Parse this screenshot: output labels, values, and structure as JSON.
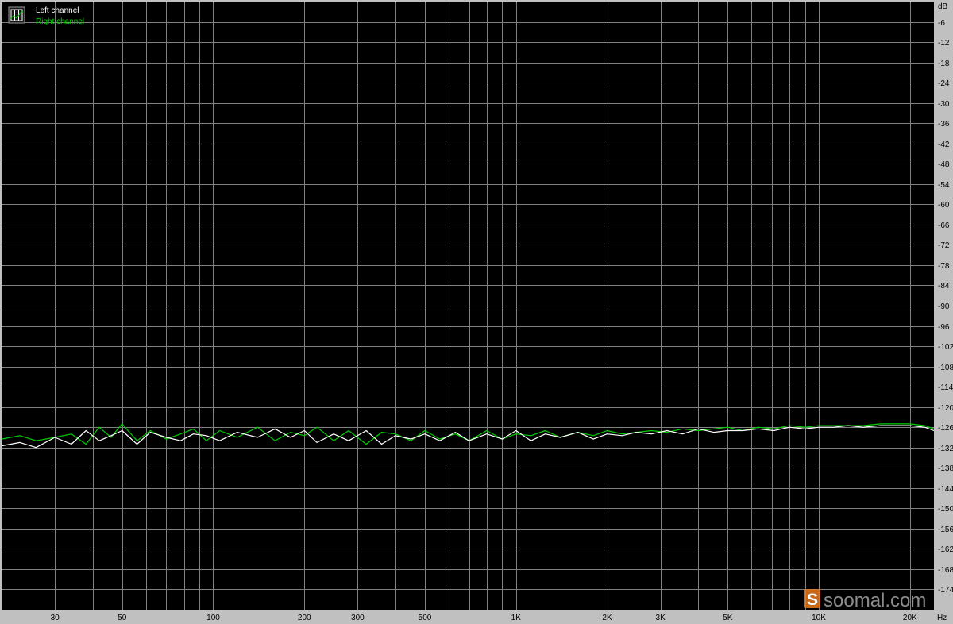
{
  "chart_data": {
    "type": "line",
    "title": "",
    "xlabel": "",
    "ylabel": "",
    "x_scale": "log",
    "xlim": [
      20,
      24000
    ],
    "ylim": [
      -180,
      0
    ],
    "x_unit": "Hz",
    "y_unit": "dB",
    "x_ticks": [
      {
        "value": 30,
        "label": "30"
      },
      {
        "value": 50,
        "label": "50"
      },
      {
        "value": 100,
        "label": "100"
      },
      {
        "value": 200,
        "label": "200"
      },
      {
        "value": 300,
        "label": "300"
      },
      {
        "value": 500,
        "label": "500"
      },
      {
        "value": 1000,
        "label": "1K"
      },
      {
        "value": 2000,
        "label": "2K"
      },
      {
        "value": 3000,
        "label": "3K"
      },
      {
        "value": 5000,
        "label": "5K"
      },
      {
        "value": 10000,
        "label": "10K"
      },
      {
        "value": 20000,
        "label": "20K"
      }
    ],
    "y_ticks": [
      -6,
      -12,
      -18,
      -24,
      -30,
      -36,
      -42,
      -48,
      -54,
      -60,
      -66,
      -72,
      -78,
      -84,
      -90,
      -96,
      -102,
      -108,
      -114,
      -120,
      -126,
      -132,
      -138,
      -144,
      -150,
      -156,
      -162,
      -168,
      -174
    ],
    "grid": true,
    "legend_position": "top-left",
    "series": [
      {
        "name": "Left channel",
        "color": "#ffffff",
        "x": [
          20,
          23,
          26,
          30,
          34,
          38,
          42,
          46,
          50,
          56,
          62,
          70,
          78,
          86,
          95,
          105,
          120,
          140,
          160,
          180,
          200,
          220,
          250,
          280,
          320,
          360,
          400,
          450,
          500,
          560,
          630,
          700,
          800,
          900,
          1000,
          1120,
          1250,
          1400,
          1600,
          1800,
          2000,
          2240,
          2500,
          2800,
          3150,
          3550,
          4000,
          4500,
          5000,
          5600,
          6300,
          7100,
          8000,
          9000,
          10000,
          11200,
          12500,
          14000,
          16000,
          18000,
          20000,
          22400,
          24000
        ],
        "y": [
          -131.5,
          -130.5,
          -132,
          -129,
          -131,
          -127,
          -130,
          -128.5,
          -127,
          -131,
          -127.5,
          -129,
          -130,
          -128,
          -128.5,
          -130,
          -127.5,
          -129,
          -126.5,
          -129,
          -127,
          -130.5,
          -128,
          -130,
          -127,
          -131,
          -128.5,
          -129.5,
          -128,
          -130,
          -127.5,
          -130,
          -128,
          -129.5,
          -127,
          -130,
          -128,
          -129,
          -127.5,
          -129.5,
          -128,
          -128.5,
          -127.5,
          -128,
          -127,
          -128,
          -126.5,
          -127.5,
          -127,
          -127,
          -126.5,
          -127,
          -126,
          -126.5,
          -126,
          -126,
          -125.5,
          -126,
          -125.5,
          -125.5,
          -125.5,
          -126,
          -127
        ]
      },
      {
        "name": "Right channel",
        "color": "#00d000",
        "x": [
          20,
          23,
          26,
          30,
          34,
          38,
          42,
          46,
          50,
          56,
          62,
          70,
          78,
          86,
          95,
          105,
          120,
          140,
          160,
          180,
          200,
          220,
          250,
          280,
          320,
          360,
          400,
          450,
          500,
          560,
          630,
          700,
          800,
          900,
          1000,
          1120,
          1250,
          1400,
          1600,
          1800,
          2000,
          2240,
          2500,
          2800,
          3150,
          3550,
          4000,
          4500,
          5000,
          5600,
          6300,
          7100,
          8000,
          9000,
          10000,
          11200,
          12500,
          14000,
          16000,
          18000,
          20000,
          22400,
          24000
        ],
        "y": [
          -129.5,
          -128.5,
          -130,
          -129,
          -128,
          -131,
          -126,
          -129,
          -125,
          -130,
          -127,
          -129.5,
          -128,
          -126.5,
          -130,
          -127,
          -129,
          -126,
          -130,
          -127.5,
          -128.5,
          -126,
          -130,
          -127,
          -131,
          -127.5,
          -128,
          -130,
          -127,
          -129.5,
          -128,
          -130,
          -127,
          -129.5,
          -128,
          -128.5,
          -127,
          -129,
          -127.5,
          -128.5,
          -127,
          -128,
          -127.5,
          -127,
          -127.5,
          -126.5,
          -127,
          -126.5,
          -126,
          -127,
          -126,
          -126.5,
          -125.5,
          -126,
          -125.5,
          -125.5,
          -125.5,
          -125.5,
          -125,
          -125,
          -125,
          -125.5,
          -126.5
        ]
      }
    ]
  },
  "watermark": {
    "logo_icon": "soomal-s-logo-icon",
    "text": "soomal.com"
  },
  "colors": {
    "plot_background": "#000000",
    "grid": "#808080",
    "frame": "#c0c0c0",
    "left_channel": "#ffffff",
    "right_channel": "#00d000",
    "logo": "#e87a1e"
  }
}
